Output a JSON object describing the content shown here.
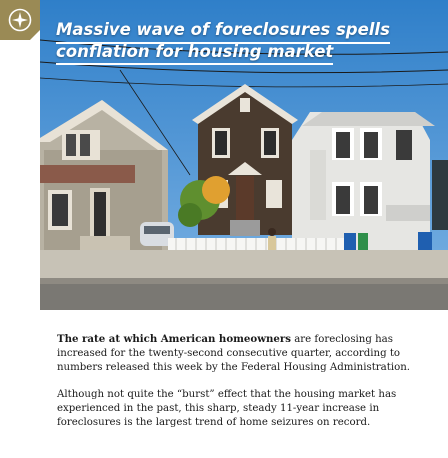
{
  "badge": {
    "icon": "compass-star-icon",
    "color": "#9a8a55"
  },
  "headline": {
    "line1": "Massive wave of foreclosures spells",
    "line2": "conflation for housing market"
  },
  "hero_image": {
    "subject": "street-of-houses-photo"
  },
  "article": {
    "p1_lead": "The rate at which American homeowners",
    "p1_rest": " are foreclosing has increased for the twenty-second consecutive quarter, according to numbers released this week by the Federal Housing Administration.",
    "p2": "Although not quite the “burst” effect that the housing market has experienced in the past, this sharp, steady 11-year increase in foreclosures is the largest trend of home seizures on record."
  }
}
